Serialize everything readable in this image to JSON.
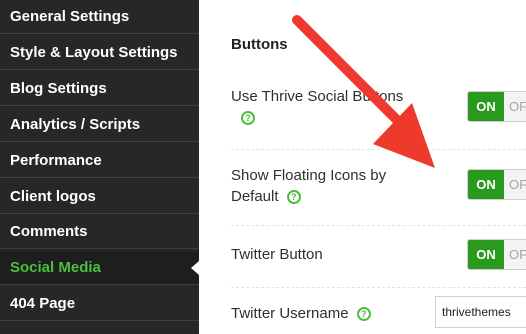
{
  "sidebar": {
    "items": [
      {
        "label": "General Settings"
      },
      {
        "label": "Style & Layout Settings"
      },
      {
        "label": "Blog Settings"
      },
      {
        "label": "Analytics / Scripts"
      },
      {
        "label": "Performance"
      },
      {
        "label": "Client logos"
      },
      {
        "label": "Comments"
      },
      {
        "label": "Social Media",
        "active": true
      },
      {
        "label": "404 Page"
      }
    ]
  },
  "main": {
    "section_title": "Buttons",
    "settings": {
      "thrive_social": {
        "label": "Use Thrive Social Buttons",
        "on_label": "ON",
        "off_label": "OFF",
        "state": "on"
      },
      "floating_icons": {
        "label_line1": "Show Floating Icons by",
        "label_line2": "Default",
        "on_label": "ON",
        "off_label": "OFF",
        "state": "on"
      },
      "twitter_button": {
        "label": "Twitter Button",
        "on_label": "ON",
        "off_label": "OFF",
        "state": "on"
      },
      "twitter_username": {
        "label": "Twitter Username",
        "value": "thrivethemes"
      }
    },
    "help_icon": "help-circle-icon",
    "help_glyph": "?"
  },
  "annotation": {
    "type": "red-arrow-icon",
    "color": "#ee3a2c"
  },
  "colors": {
    "sidebar_bg": "#272727",
    "active_green": "#4bbf3d",
    "toggle_on_green": "#2a9a1e"
  }
}
